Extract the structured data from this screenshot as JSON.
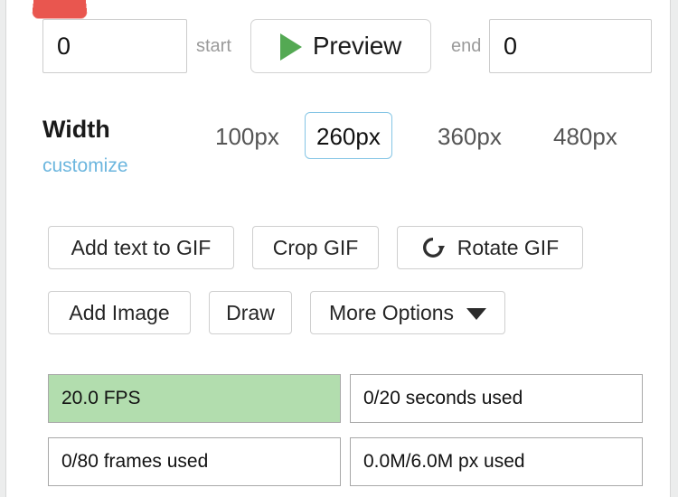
{
  "trim": {
    "start_value": "0",
    "start_placeholder": "0",
    "start_label": "start",
    "end_value": "0",
    "end_placeholder": "0",
    "end_label": "end",
    "preview_label": "Preview",
    "play_icon": "play-icon"
  },
  "width": {
    "title": "Width",
    "customize_label": "customize",
    "options": [
      {
        "label": "100px",
        "selected": false
      },
      {
        "label": "260px",
        "selected": true
      },
      {
        "label": "360px",
        "selected": false
      },
      {
        "label": "480px",
        "selected": false
      }
    ],
    "selected_value": "260px"
  },
  "tools": {
    "add_text_label": "Add text to GIF",
    "crop_label": "Crop GIF",
    "rotate_label": "Rotate GIF",
    "rotate_icon": "rotate-clockwise-icon",
    "add_image_label": "Add Image",
    "draw_label": "Draw",
    "more_options_label": "More Options",
    "more_options_icon": "caret-down-icon"
  },
  "status": {
    "fps": "20.0 FPS",
    "seconds_used": "0/20 seconds used",
    "frames_used": "0/80 frames used",
    "pixels_used": "0.0M/6.0M px used"
  },
  "colors": {
    "accent_blue": "#85c5e5",
    "link_blue": "#6cb6de",
    "play_green": "#54a953",
    "fps_green": "#b2ddae",
    "red_tab": "#e9564f",
    "page_background": "#eceded"
  }
}
